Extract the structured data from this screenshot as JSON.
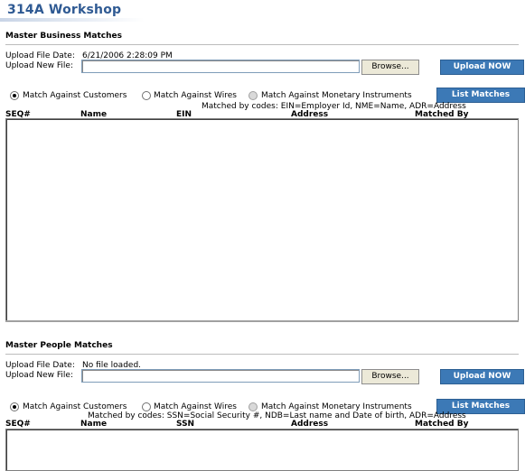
{
  "page": {
    "title": "314A Workshop"
  },
  "business": {
    "section_title": "Master Business Matches",
    "upload_date_label": "Upload File Date:",
    "upload_date_value": "6/21/2006 2:28:09 PM",
    "upload_new_label": "Upload New File:",
    "file_value": "",
    "browse_label": "Browse...",
    "upload_button": "Upload NOW",
    "radios": [
      {
        "label": "Match Against Customers",
        "checked": true
      },
      {
        "label": "Match Against Wires",
        "checked": false
      },
      {
        "label": "Match Against Monetary Instruments",
        "checked": false
      }
    ],
    "list_button": "List Matches",
    "codes_text": "Matched by codes: EIN=Employer Id, NME=Name, ADR=Address",
    "columns": [
      "SEQ#",
      "Name",
      "EIN",
      "Address",
      "Matched By"
    ],
    "rows": []
  },
  "people": {
    "section_title": "Master People Matches",
    "upload_date_label": "Upload File Date:",
    "upload_date_value": "No file loaded.",
    "upload_new_label": "Upload New File:",
    "file_value": "",
    "browse_label": "Browse...",
    "upload_button": "Upload NOW",
    "radios": [
      {
        "label": "Match Against Customers",
        "checked": true
      },
      {
        "label": "Match Against Wires",
        "checked": false
      },
      {
        "label": "Match Against Monetary Instruments",
        "checked": false
      }
    ],
    "list_button": "List Matches",
    "codes_text": "Matched by codes: SSN=Social Security #, NDB=Last name and Date of birth, ADR=Address",
    "columns": [
      "SEQ#",
      "Name",
      "SSN",
      "Address",
      "Matched By"
    ],
    "rows": []
  }
}
